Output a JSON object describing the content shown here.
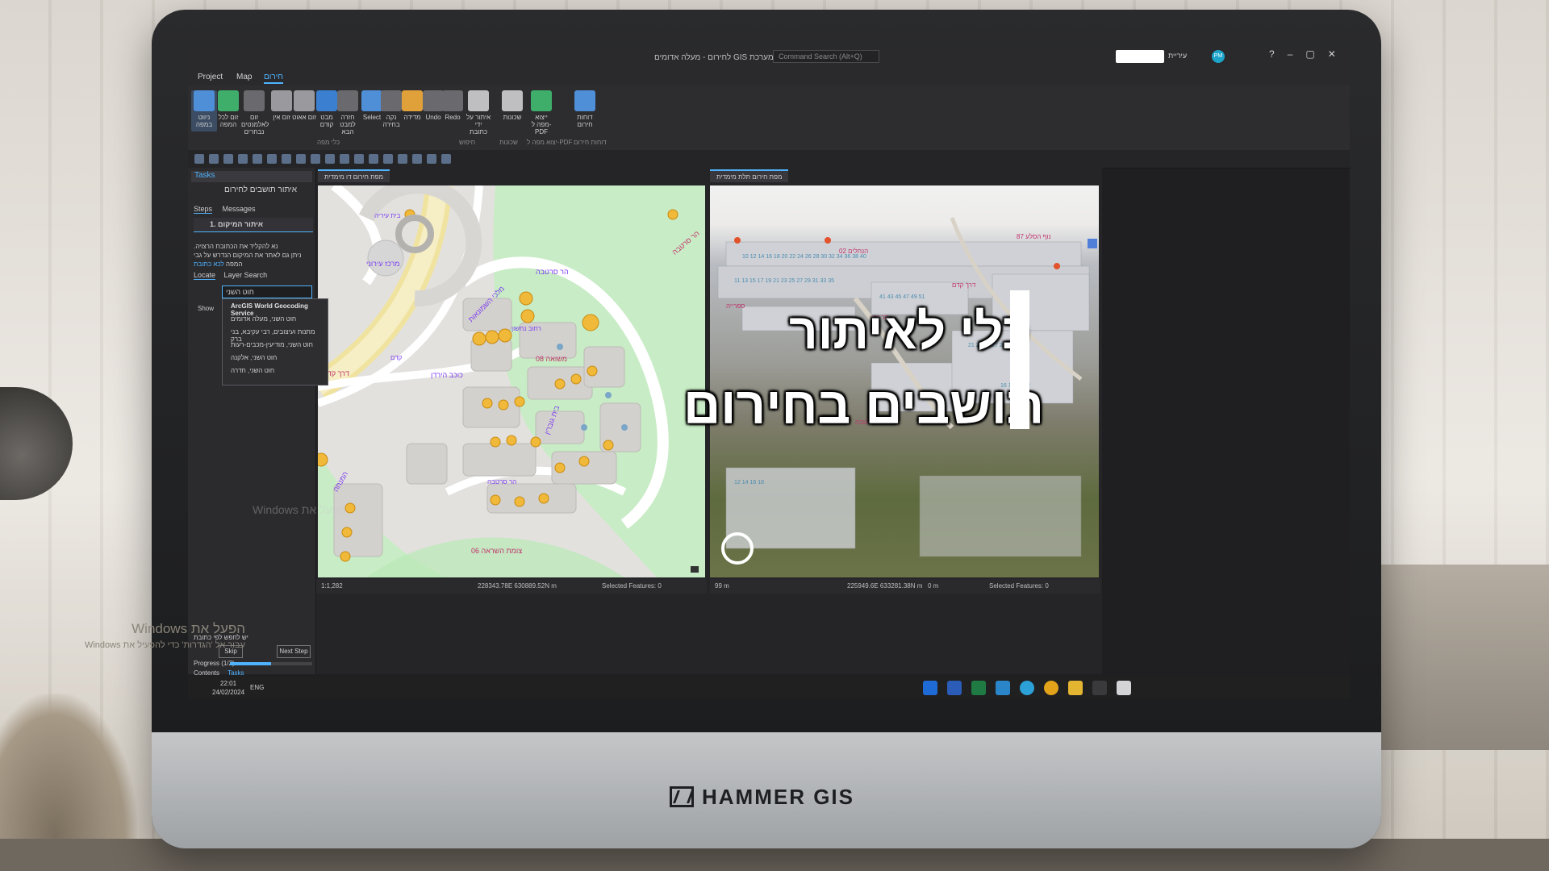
{
  "app": {
    "window_title": "לחירום - מעלה אדומים GIS מערכת",
    "command_search_placeholder": "Command Search (Alt+Q)",
    "user_name": "עיריית",
    "user_initials": "PM",
    "menu": [
      "Project",
      "Map",
      "חירום"
    ],
    "ribbon_buttons": [
      {
        "label": "ניווט במפה",
        "color": "#4e8fd8"
      },
      {
        "label": "זום לכל המפה",
        "color": "#3fae6b"
      },
      {
        "label": "זום לאלמנטים נבחרים",
        "color": "#6a6a6e"
      },
      {
        "label": "זום אין",
        "color": "#9a9a9e"
      },
      {
        "label": "זום אאוט",
        "color": "#9a9a9e"
      },
      {
        "label": "מבט קודם",
        "color": "#3a7fd0"
      },
      {
        "label": "חזרה למבט הבא",
        "color": "#6a6a6e"
      },
      {
        "label": "Select",
        "color": "#4e8fd8"
      },
      {
        "label": "נקה בחירה",
        "color": "#6a6a6e"
      },
      {
        "label": "מדידה",
        "color": "#e0a03a"
      },
      {
        "label": "Undo",
        "color": "#6a6a6e"
      },
      {
        "label": "Redo",
        "color": "#6a6a6e"
      },
      {
        "label": "איתור על ידי כתובת",
        "color": "#bfbfc2"
      },
      {
        "label": "שכונות",
        "color": "#bfbfc2"
      },
      {
        "label": "ייצוא מפה ל-PDF",
        "color": "#3fae6b"
      },
      {
        "label": "דוחות חירום",
        "color": "#4e8fd8"
      }
    ],
    "ribbon_groups": [
      "כלי מפה",
      "חיפוש",
      "שכונות",
      "יצוא מפה ל-PDF",
      "דוחות חירום"
    ]
  },
  "tasks": {
    "pane_title": "Tasks",
    "task_name": "איתור תושבים לחירום",
    "tabs": [
      "Steps",
      "Messages"
    ],
    "step": "1.  איתור המיקום",
    "instructions": ".נא להקליד את הכתובת הרצויה",
    "instructions2": "ניתן גם לאתר את המיקום הנדרש על גבי המפה",
    "instructions_link": "לכא כתובת",
    "locate_tabs": [
      "Locate",
      "Layer Search"
    ],
    "search_value": "חוט השני",
    "dropdown": [
      "ArcGIS World Geocoding Service",
      "חוט השני, מעלה אדומים",
      "מתנות ועיצובים, רבי עקיבא, בני ברק",
      "חוט השני, מודיעין-מכבים-רעות",
      "חוט השני, אלקנה",
      "חוט השני, חדרה"
    ],
    "show_label": "Show",
    "hint": "יש לחפש לפי כתובת",
    "skip_label": "Skip",
    "next_label": "Next Step",
    "progress_label": "Progress (1/2)",
    "progress_fraction": 0.5,
    "bottom_tabs": [
      "Contents",
      "Tasks"
    ]
  },
  "map2d": {
    "tab": "מפת חירום דו מימדית",
    "scale": "1:1,282",
    "coords": "228343.78E 630889.52N m",
    "selected": "Selected Features: 0",
    "labels": [
      "דרך קדם",
      "מרכז עירוני",
      "בית עיריה",
      "הר סרטבה",
      "מלכי השמונאות",
      "כוכב הירדן",
      "רחוב נחשון",
      "משואה 08",
      "בית גוברין",
      "הר סרטבה",
      "צומת השראה 06",
      "המנחה",
      "קדם",
      "הר סרטבה"
    ]
  },
  "map3d": {
    "tab": "מפת חירום תלת מימדית",
    "scale": "99 m",
    "coords": "225949.6E 633281.38N m",
    "elevation": "0 m",
    "selected": "Selected Features: 0",
    "labels": [
      "נוף הסלע 87",
      "הנחלים 02",
      "דרך קדם",
      "ספרייה",
      "הר נבו",
      "הר סרטבה"
    ]
  },
  "overlay": {
    "line1": "כלי לאיתור",
    "line2": "תושבים בחירום"
  },
  "taskbar": {
    "time": "22:01",
    "date": "24/02/2024",
    "lang": "ENG"
  },
  "screen_watermark": "Windows הפעל את",
  "activation": {
    "line1": "Windows הפעל את",
    "line2": "Windows עבור אל 'הגדרות' כדי להפעיל את"
  },
  "brand": "HAMMER GIS"
}
